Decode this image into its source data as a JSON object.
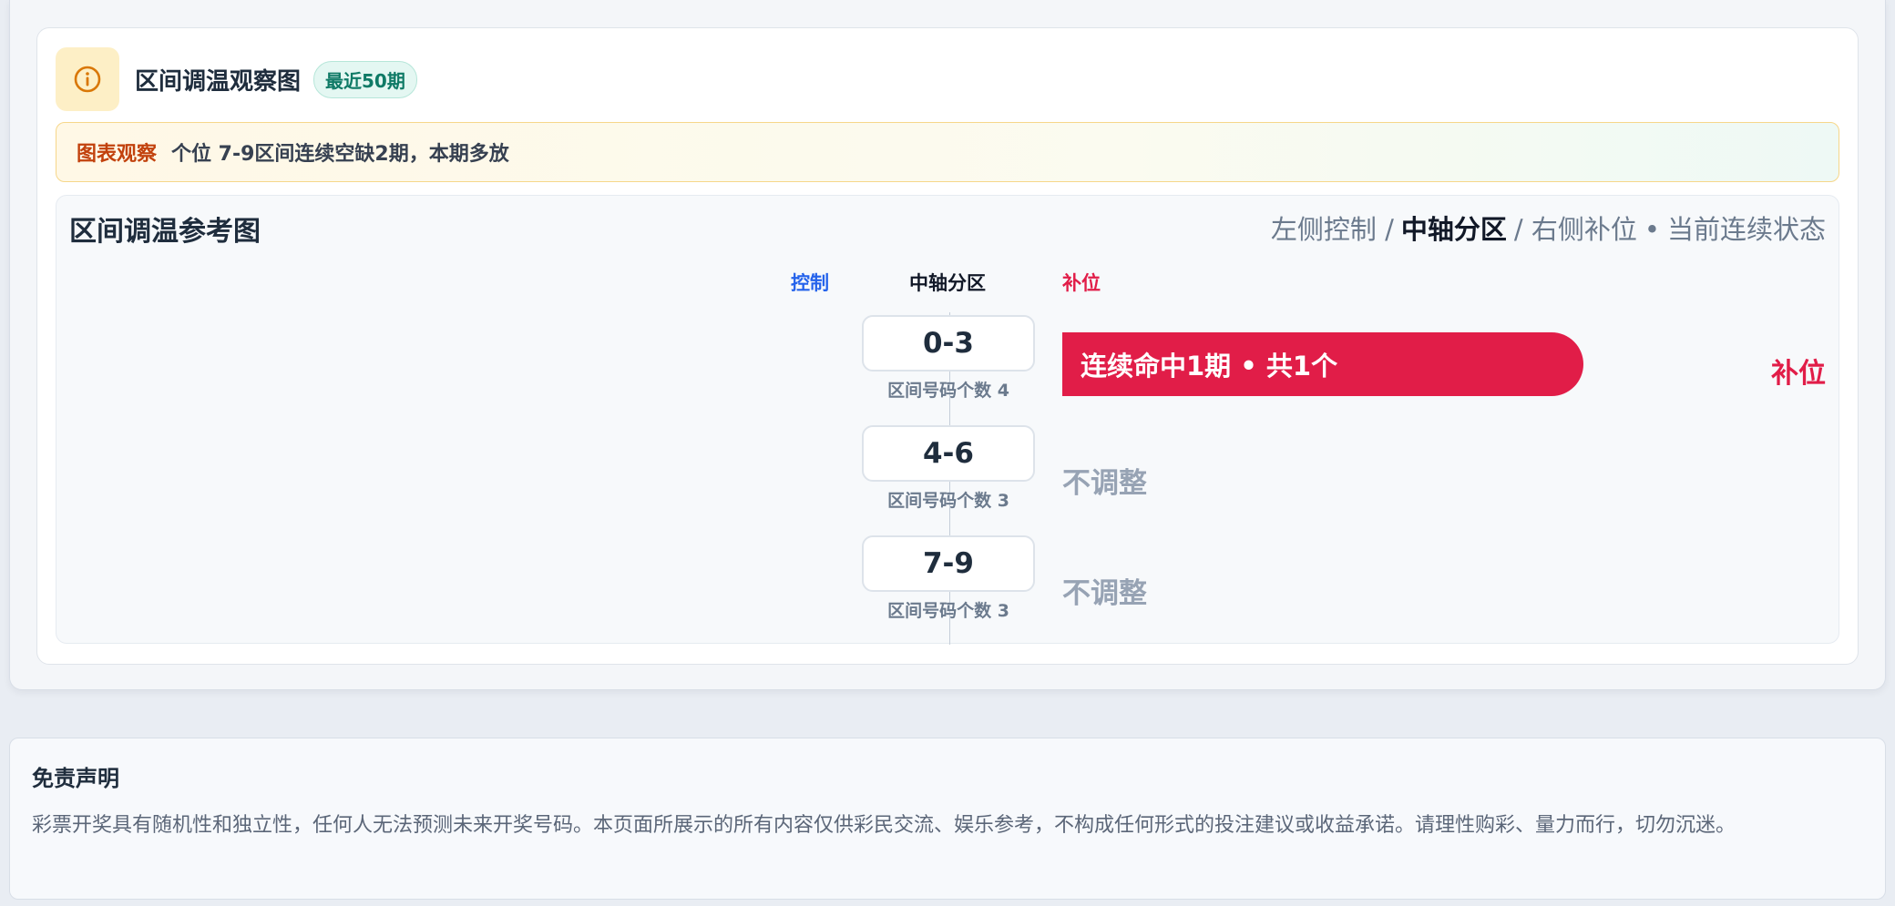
{
  "card": {
    "title": "区间调温观察图",
    "badge": "最近50期",
    "info_icon": "info-circle-icon",
    "observe_tag": "图表观察",
    "observe_text": "个位 7-9区间连续空缺2期，本期多放"
  },
  "panel": {
    "title": "区间调温参考图",
    "legend": {
      "left": "左侧控制 /",
      "middle": "中轴分区",
      "right": "/ 右侧补位",
      "dot": "•",
      "state": "当前连续状态"
    },
    "columns": {
      "control": "控制",
      "mid": "中轴分区",
      "fill": "补位"
    },
    "zones": [
      {
        "range": "0-3",
        "sub": "区间号码个数 4",
        "bar": "连续命中1期 • 共1个",
        "right_label": "补位"
      },
      {
        "range": "4-6",
        "sub": "区间号码个数 3",
        "status": "不调整"
      },
      {
        "range": "7-9",
        "sub": "区间号码个数 3",
        "status": "不调整"
      }
    ]
  },
  "disclaimer": {
    "title": "免责声明",
    "text": "彩票开奖具有随机性和独立性，任何人无法预测未来开奖号码。本页面所展示的所有内容仅供彩民交流、娱乐参考，不构成任何形式的投注建议或收益承诺。请理性购彩、量力而行，切勿沉迷。"
  },
  "colors": {
    "accent_fill": "#e11d48",
    "control": "#2563eb",
    "badge_green": "#0f7a66",
    "observe_tag": "#c2410c"
  }
}
